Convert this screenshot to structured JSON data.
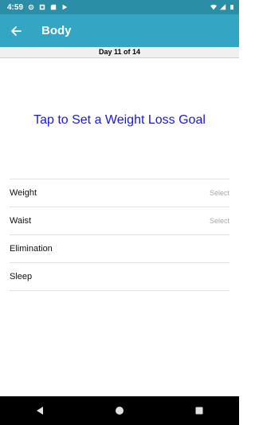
{
  "status_bar": {
    "time": "4:59",
    "left_icons": [
      "gear-icon",
      "notification-icon",
      "sd-card-icon",
      "play-store-icon"
    ],
    "right_icons": [
      "wifi-icon",
      "signal-icon",
      "battery-icon"
    ]
  },
  "app_bar": {
    "title": "Body",
    "back_icon": "arrow-back-icon",
    "background": "#33a6c4"
  },
  "day_bar": {
    "text": "Day 11 of 14"
  },
  "goal": {
    "text": "Tap to Set a Weight Loss Goal",
    "color": "#1a1ad6"
  },
  "items": [
    {
      "label": "Weight",
      "value": "Select"
    },
    {
      "label": "Waist",
      "value": "Select"
    },
    {
      "label": "Elimination",
      "value": ""
    },
    {
      "label": "Sleep",
      "value": ""
    }
  ],
  "nav_bar": {
    "icons": [
      "back-triangle-icon",
      "home-circle-icon",
      "recents-square-icon"
    ]
  }
}
